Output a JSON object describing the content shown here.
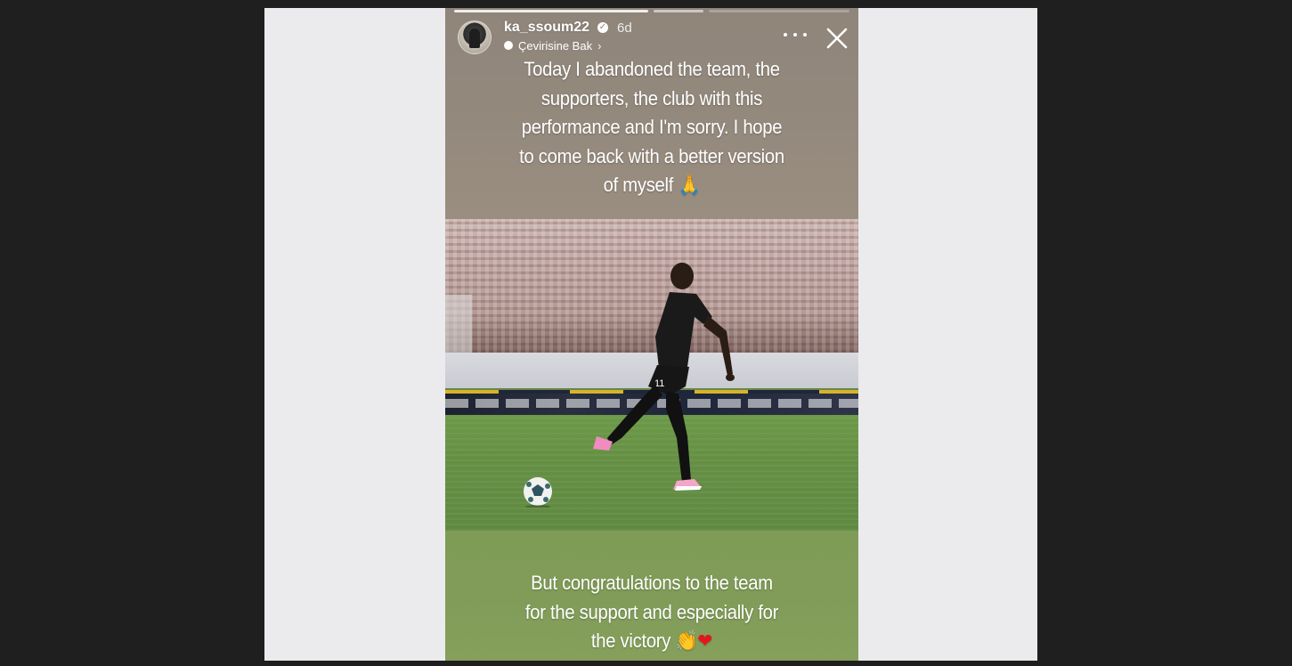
{
  "story": {
    "username": "ka_ssoum22",
    "verified_icon": "verified-check-icon",
    "time_ago": "6d",
    "translate_label": "Çevirisine Bak",
    "translate_chevron": "›",
    "more_icon": "more-horizontal-icon",
    "close_icon": "close-icon",
    "caption_top": {
      "lines": [
        "Today I abandoned the team, the",
        "supporters, the club with this",
        "performance and I'm sorry. I hope",
        "to come back with a better version",
        "of myself"
      ],
      "emoji": "🙏"
    },
    "caption_bottom": {
      "lines": [
        "But congratulations to the team",
        "for the support and especially for",
        "the victory"
      ],
      "emoji_clap": "👏",
      "emoji_heart": "❤"
    },
    "player_number": "11",
    "colors": {
      "top_band": "#92877b",
      "pitch": "#6a9447",
      "lower_band": "#809c58",
      "backdrop": "#ebebee",
      "page_bg": "#1f1f1f"
    }
  }
}
